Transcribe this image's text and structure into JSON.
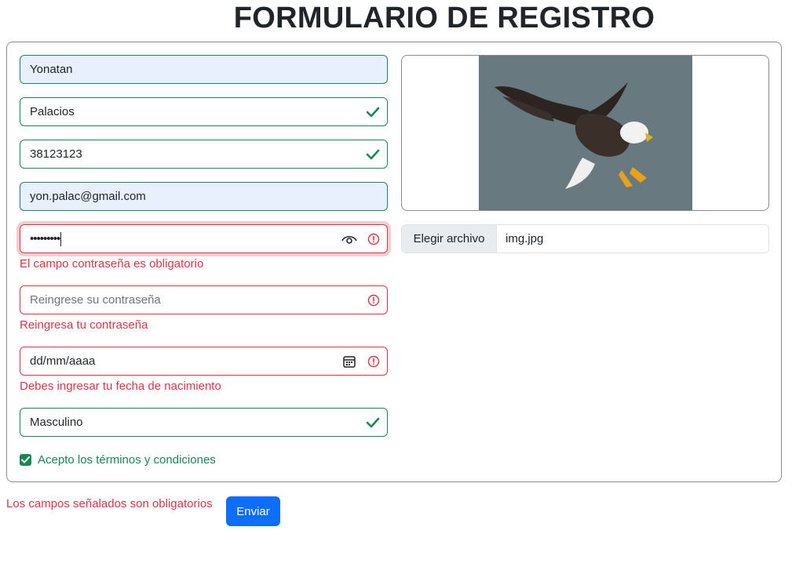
{
  "title": "FORMULARIO DE REGISTRO",
  "form": {
    "nombre": "Yonatan",
    "apellido": "Palacios",
    "dni": "38123123",
    "email": "yon.palac@gmail.com",
    "password_mask": "•••••••••",
    "password_error": "El campo contraseña es obligatorio",
    "repassword_placeholder": "Reingrese su contraseña",
    "repassword_error": "Reingresa tu contraseña",
    "fecha_placeholder": "dd/mm/aaaa",
    "fecha_error": "Debes ingresar tu fecha de nacimiento",
    "genero": "Masculino",
    "terminos_label": "Acepto los términos y condiciones"
  },
  "file": {
    "button_label": "Elegir archivo",
    "filename": "img.jpg"
  },
  "footer": {
    "message": "Los campos señalados son obligatorios",
    "submit_label": "Enviar"
  },
  "colors": {
    "valid": "#198754",
    "invalid": "#dc3545",
    "primary": "#0d6efd"
  },
  "icons": {
    "valid": "check-icon",
    "invalid": "exclamation-circle-icon",
    "show_password": "eye-icon",
    "calendar": "calendar-icon"
  }
}
